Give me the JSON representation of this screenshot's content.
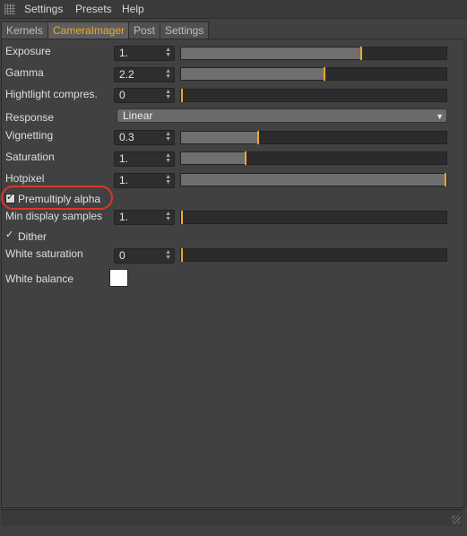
{
  "menubar": {
    "items": [
      "Settings",
      "Presets",
      "Help"
    ]
  },
  "tabs": [
    {
      "label": "Kernels",
      "active": false
    },
    {
      "label": "CameraImager",
      "active": true
    },
    {
      "label": "Post",
      "active": false
    },
    {
      "label": "Settings",
      "active": false
    }
  ],
  "params": {
    "exposure": {
      "label": "Exposure",
      "value": "1.",
      "level": 0.68
    },
    "gamma": {
      "label": "Gamma",
      "value": "2.2",
      "level": 0.54
    },
    "highlight": {
      "label": "Hightlight compres.",
      "value": "0",
      "level": 0.0
    },
    "response": {
      "label": "Response",
      "value": "Linear"
    },
    "vignetting": {
      "label": "Vignetting",
      "value": "0.3",
      "level": 0.29
    },
    "saturation": {
      "label": "Saturation",
      "value": "1.",
      "level": 0.24
    },
    "hotpixel": {
      "label": "Hotpixel",
      "value": "1.",
      "level": 1.0
    },
    "premultiply": {
      "label": "Premultiply alpha",
      "checked": true,
      "highlighted": true
    },
    "min_display": {
      "label": "Min display samples",
      "value": "1.",
      "level": 0.0
    },
    "dither": {
      "label": "Dither",
      "checked": true
    },
    "white_sat": {
      "label": "White saturation",
      "value": "0",
      "level": 0.0
    },
    "white_bal": {
      "label": "White balance",
      "color": "#ffffff"
    }
  },
  "colors": {
    "accent": "#f4a628",
    "highlight_ring": "#e0332b"
  }
}
